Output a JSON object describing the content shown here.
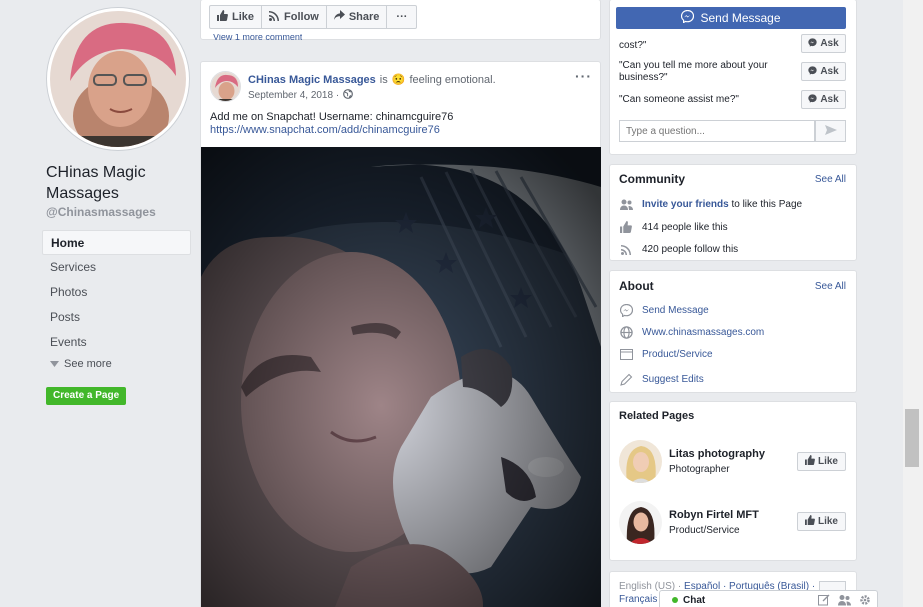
{
  "page": {
    "name": "CHinas Magic Massages",
    "handle": "@Chinasmassages"
  },
  "nav": {
    "items": [
      "Home",
      "Services",
      "Photos",
      "Posts",
      "Events"
    ],
    "see_more": "See more",
    "create_page": "Create a Page"
  },
  "prev_post": {
    "like": "Like",
    "follow": "Follow",
    "share": "Share",
    "more": "···",
    "view_comment": "View 1 more comment"
  },
  "post": {
    "author": "CHinas Magic Massages",
    "is": "is",
    "feeling_emoji": "😟",
    "feeling": "feeling emotional.",
    "date": "September 4, 2018 ·",
    "text": "Add me on Snapchat! Username: chinamcguire76",
    "link": "https://www.snapchat.com/add/chinamcguire76",
    "menu": "···"
  },
  "messaging": {
    "send_message": "Send Message",
    "questions": [
      "cost?\"",
      "\"Can you tell me more about your business?\"",
      "\"Can someone assist me?\""
    ],
    "ask": "Ask",
    "placeholder": "Type a question..."
  },
  "community": {
    "title": "Community",
    "see_all": "See All",
    "invite": "Invite your friends",
    "invite_rest": "to like this Page",
    "likes": "414 people like this",
    "follows": "420 people follow this"
  },
  "about": {
    "title": "About",
    "see_all": "See All",
    "send_message": "Send Message",
    "website": "Www.chinasmassages.com",
    "category": "Product/Service",
    "suggest": "Suggest Edits"
  },
  "related": {
    "title": "Related Pages",
    "pages": [
      {
        "name": "Litas photography",
        "category": "Photographer"
      },
      {
        "name": "Robyn Firtel MFT",
        "category": "Product/Service"
      }
    ],
    "like": "Like"
  },
  "languages": {
    "line1_prefix": "English (US) ·",
    "line1_links": "Español · Português (Brasil) ·",
    "line2": "Français ("
  },
  "chat": {
    "label": "Chat"
  },
  "colors": {
    "fb_blue": "#4267b2",
    "link": "#385898",
    "green": "#42b72a"
  }
}
